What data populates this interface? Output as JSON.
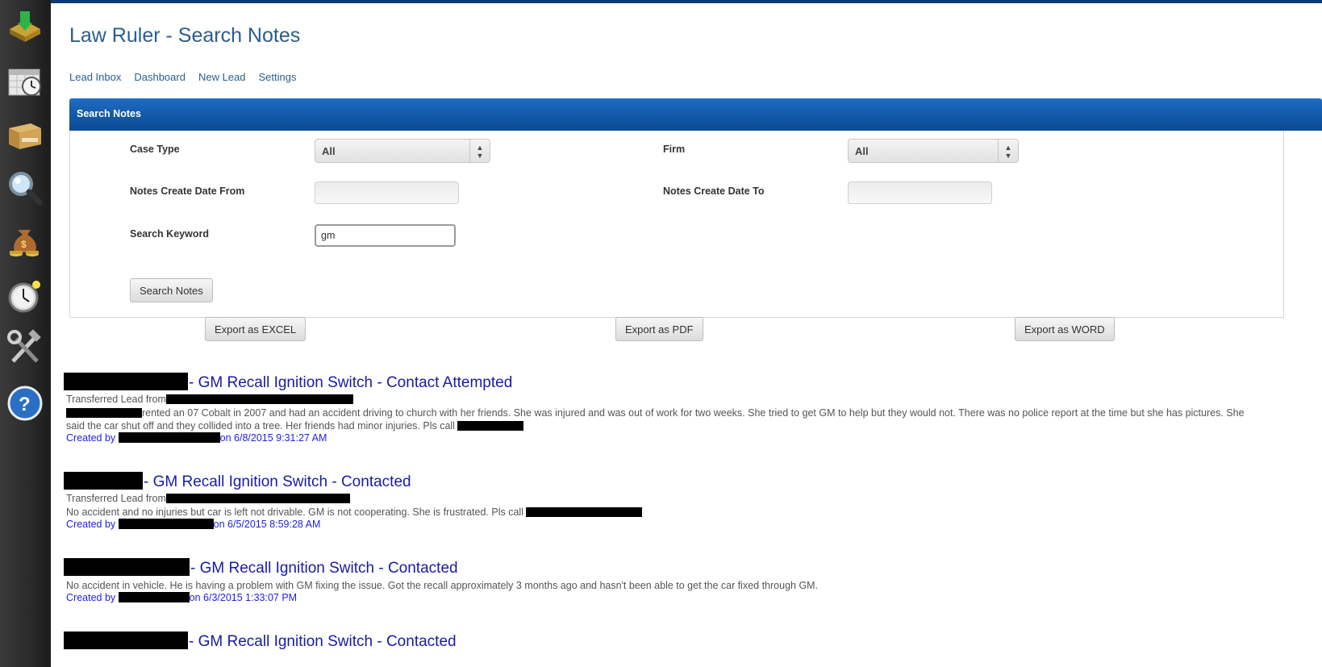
{
  "app": {
    "title": "Law Ruler - Search Notes"
  },
  "sidebar": {
    "icons": [
      {
        "name": "leads-inbox-icon"
      },
      {
        "name": "calendar-clock-icon"
      },
      {
        "name": "reports-box-icon"
      },
      {
        "name": "search-magnifier-icon"
      },
      {
        "name": "money-bag-icon"
      },
      {
        "name": "timer-icon"
      },
      {
        "name": "tools-icon"
      },
      {
        "name": "help-icon"
      }
    ]
  },
  "nav": {
    "items": [
      "Lead Inbox",
      "Dashboard",
      "New Lead",
      "Settings"
    ]
  },
  "panel": {
    "title": "Search Notes",
    "case_type_label": "Case Type",
    "case_type_value": "All",
    "firm_label": "Firm",
    "firm_value": "All",
    "date_from_label": "Notes Create Date From",
    "date_from_value": "",
    "date_to_label": "Notes Create Date To",
    "date_to_value": "",
    "keyword_label": "Search Keyword",
    "keyword_value": "gm",
    "search_button": "Search Notes"
  },
  "export": {
    "excel": "Export as EXCEL",
    "pdf": "Export as PDF",
    "word": "Export as WORD"
  },
  "results": [
    {
      "title": "- GM Recall Ignition Switch - Contact Attempted",
      "transferred": "Transferred Lead from",
      "body_part1": "rented an 07 Cobalt in 2007 and had an accident driving to church with her friends. She was injured and was out of work for two weeks. She tried to get GM to help but they would not. There was no police report at the time but she has pictures. She said the car shut off and they collided into a tree. Her friends had minor injuries. Pls call",
      "created_prefix": "Created by",
      "created_suffix": "on 6/8/2015 9:31:27 AM"
    },
    {
      "title": "- GM Recall Ignition Switch - Contacted",
      "transferred": "Transferred Lead from",
      "body_part1": "No accident and no injuries but car is left not drivable. GM is not cooperating. She is frustrated. Pls call",
      "created_prefix": "Created by",
      "created_suffix": "on 6/5/2015 8:59:28 AM"
    },
    {
      "title": "- GM Recall Ignition Switch - Contacted",
      "body_part1": "No accident in vehicle. He is having a problem with GM fixing the issue. Got the recall approximately 3 months ago and hasn't been able to get the car fixed through GM.",
      "created_prefix": "Created by",
      "created_suffix": "on 6/3/2015 1:33:07 PM"
    },
    {
      "title": "- GM Recall Ignition Switch - Contacted"
    }
  ],
  "colors": {
    "header_blue": "#1258a8",
    "link_blue": "#2a5d8f",
    "result_title": "#1a1aa6",
    "created_by": "#1f1fe0"
  }
}
